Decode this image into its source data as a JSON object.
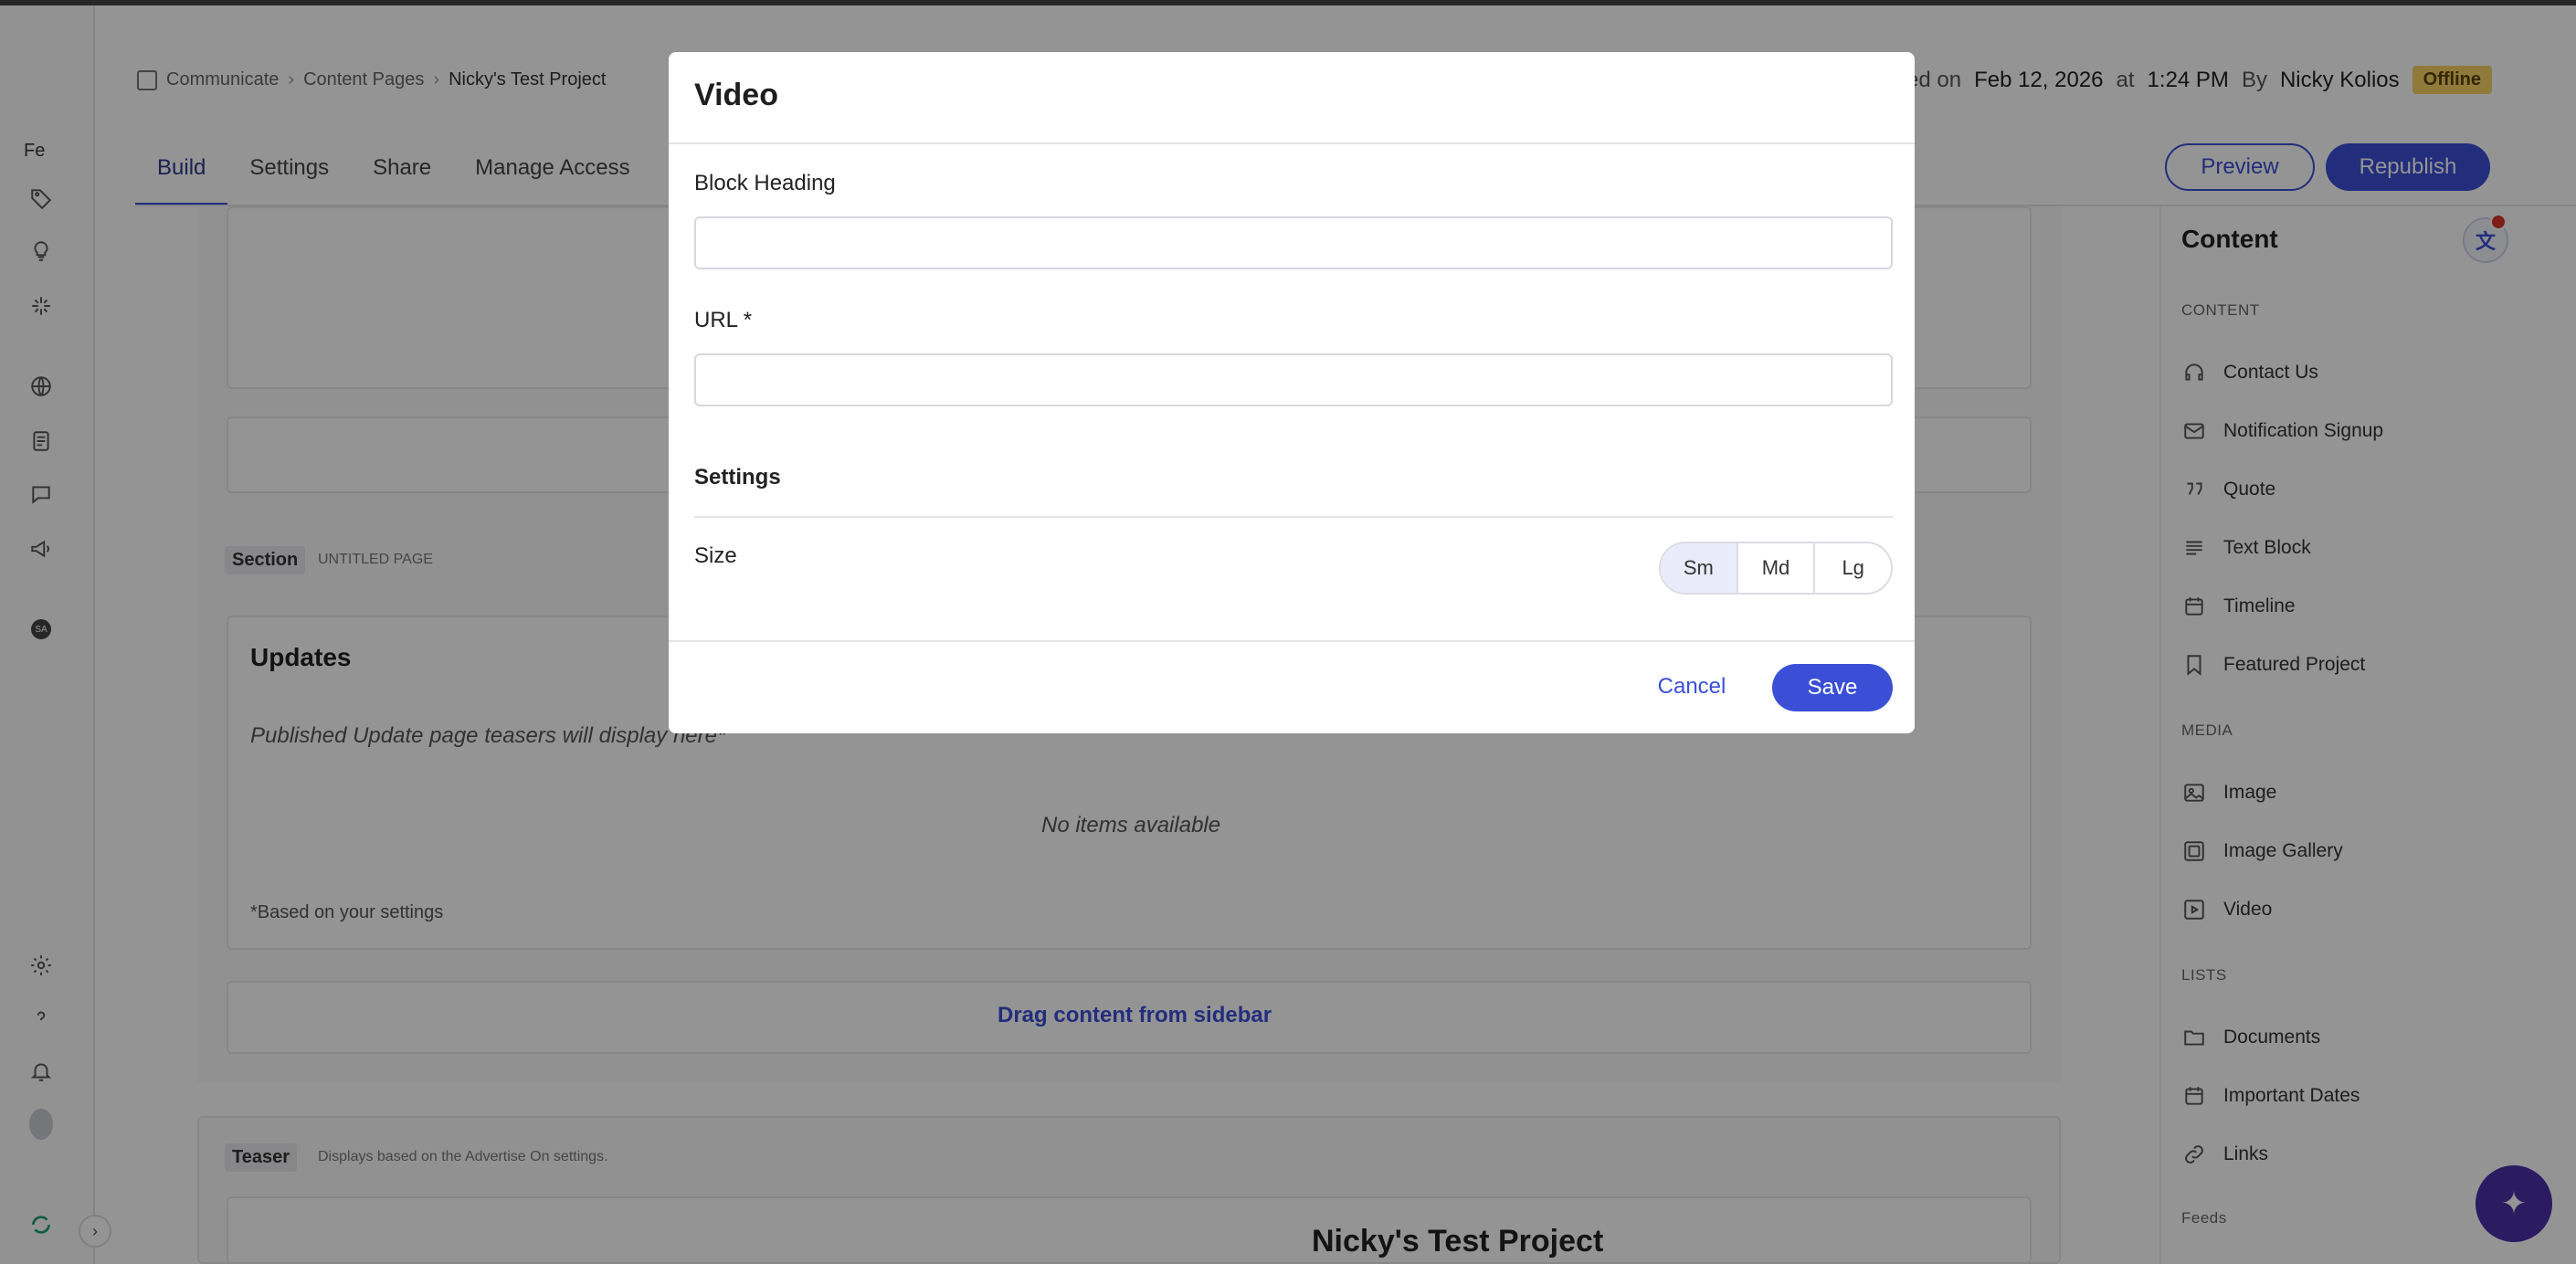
{
  "rail": {
    "org_initials": "Fe",
    "icons": [
      "tag-icon",
      "lightbulb-icon",
      "sparkle-icon",
      "globe-icon",
      "document-icon",
      "chat-icon",
      "megaphone-icon",
      "avatar-badge-icon",
      "gear-icon",
      "help-icon",
      "bell-icon",
      "user-avatar-icon",
      "refresh-logo-icon"
    ],
    "avatar_badge": "SA"
  },
  "breadcrumb": {
    "items": [
      "Communicate",
      "Content Pages",
      "Nicky's Test Project"
    ]
  },
  "header_meta": {
    "prefix": "ted on",
    "date": "Feb 12, 2026",
    "at_label": "at",
    "time": "1:24 PM",
    "by_label": "By",
    "author": "Nicky Kolios",
    "status": "Offline"
  },
  "tabs": [
    "Build",
    "Settings",
    "Share",
    "Manage Access"
  ],
  "actions": {
    "preview": "Preview",
    "republish": "Republish"
  },
  "canvas": {
    "section_tag": "Section",
    "section_sub": "UNTITLED PAGE",
    "updates_title": "Updates",
    "updates_note": "Published Update page teasers will display here*",
    "no_items": "No items available",
    "footnote": "*Based on your settings",
    "drag_text": "Drag content from sidebar",
    "teaser_tag": "Teaser",
    "teaser_sub": "Displays based on the Advertise On settings.",
    "teaser_title": "Nicky's Test Project"
  },
  "sidebar": {
    "title": "Content",
    "groups": {
      "content": "CONTENT",
      "media": "MEDIA",
      "lists": "LISTS",
      "feeds": "Feeds"
    },
    "content_items": [
      "Contact Us",
      "Notification Signup",
      "Quote",
      "Text Block",
      "Timeline",
      "Featured Project"
    ],
    "media_items": [
      "Image",
      "Image Gallery",
      "Video"
    ],
    "list_items": [
      "Documents",
      "Important Dates",
      "Links"
    ]
  },
  "modal": {
    "title": "Video",
    "block_heading_label": "Block Heading",
    "block_heading_value": "",
    "url_label": "URL *",
    "url_value": "",
    "settings_label": "Settings",
    "size_label": "Size",
    "size_options": [
      "Sm",
      "Md",
      "Lg"
    ],
    "size_selected": "Sm",
    "cancel": "Cancel",
    "save": "Save"
  },
  "colors": {
    "accent": "#3b4fd6",
    "offline_badge": "#f6d365",
    "overlay": "rgba(0,0,0,0.42)"
  }
}
